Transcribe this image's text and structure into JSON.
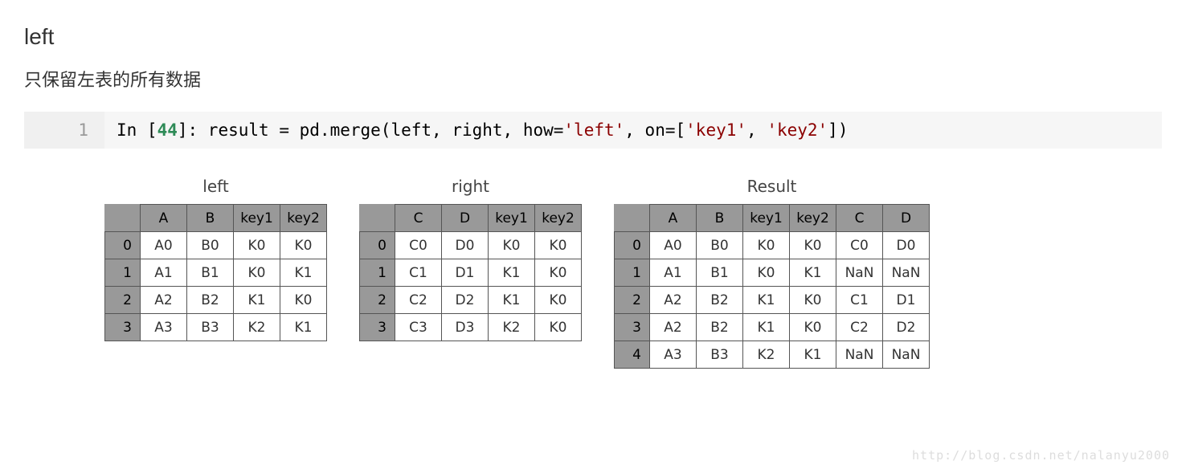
{
  "heading": "left",
  "description": "只保留左表的所有数据",
  "code": {
    "line_number": "1",
    "prefix": "In [",
    "cell_num": "44",
    "suffix1": "]: result ",
    "eq": "=",
    "suffix2": " pd",
    "dot": ".",
    "merge": "merge",
    "paren_open": "(",
    "arg_left": "left",
    "comma1": ", ",
    "arg_right": "right",
    "comma2": ", how",
    "eq2": "=",
    "str_left": "'left'",
    "comma3": ", on",
    "eq3": "=",
    "br_open": "[",
    "str_key1": "'key1'",
    "comma4": ", ",
    "str_key2": "'key2'",
    "br_close": "]",
    "paren_close": ")"
  },
  "tables": {
    "left": {
      "title": "left",
      "columns": [
        "A",
        "B",
        "key1",
        "key2"
      ],
      "index": [
        "0",
        "1",
        "2",
        "3"
      ],
      "data": [
        [
          "A0",
          "B0",
          "K0",
          "K0"
        ],
        [
          "A1",
          "B1",
          "K0",
          "K1"
        ],
        [
          "A2",
          "B2",
          "K1",
          "K0"
        ],
        [
          "A3",
          "B3",
          "K2",
          "K1"
        ]
      ]
    },
    "right": {
      "title": "right",
      "columns": [
        "C",
        "D",
        "key1",
        "key2"
      ],
      "index": [
        "0",
        "1",
        "2",
        "3"
      ],
      "data": [
        [
          "C0",
          "D0",
          "K0",
          "K0"
        ],
        [
          "C1",
          "D1",
          "K1",
          "K0"
        ],
        [
          "C2",
          "D2",
          "K1",
          "K0"
        ],
        [
          "C3",
          "D3",
          "K2",
          "K0"
        ]
      ]
    },
    "result": {
      "title": "Result",
      "columns": [
        "A",
        "B",
        "key1",
        "key2",
        "C",
        "D"
      ],
      "index": [
        "0",
        "1",
        "2",
        "3",
        "4"
      ],
      "data": [
        [
          "A0",
          "B0",
          "K0",
          "K0",
          "C0",
          "D0"
        ],
        [
          "A1",
          "B1",
          "K0",
          "K1",
          "NaN",
          "NaN"
        ],
        [
          "A2",
          "B2",
          "K1",
          "K0",
          "C1",
          "D1"
        ],
        [
          "A2",
          "B2",
          "K1",
          "K0",
          "C2",
          "D2"
        ],
        [
          "A3",
          "B3",
          "K2",
          "K1",
          "NaN",
          "NaN"
        ]
      ]
    }
  },
  "watermark": "http://blog.csdn.net/nalanyu2000",
  "chart_data": [
    {
      "type": "table",
      "title": "left",
      "columns": [
        "A",
        "B",
        "key1",
        "key2"
      ],
      "index": [
        0,
        1,
        2,
        3
      ],
      "data": [
        [
          "A0",
          "B0",
          "K0",
          "K0"
        ],
        [
          "A1",
          "B1",
          "K0",
          "K1"
        ],
        [
          "A2",
          "B2",
          "K1",
          "K0"
        ],
        [
          "A3",
          "B3",
          "K2",
          "K1"
        ]
      ]
    },
    {
      "type": "table",
      "title": "right",
      "columns": [
        "C",
        "D",
        "key1",
        "key2"
      ],
      "index": [
        0,
        1,
        2,
        3
      ],
      "data": [
        [
          "C0",
          "D0",
          "K0",
          "K0"
        ],
        [
          "C1",
          "D1",
          "K1",
          "K0"
        ],
        [
          "C2",
          "D2",
          "K1",
          "K0"
        ],
        [
          "C3",
          "D3",
          "K2",
          "K0"
        ]
      ]
    },
    {
      "type": "table",
      "title": "Result",
      "columns": [
        "A",
        "B",
        "key1",
        "key2",
        "C",
        "D"
      ],
      "index": [
        0,
        1,
        2,
        3,
        4
      ],
      "data": [
        [
          "A0",
          "B0",
          "K0",
          "K0",
          "C0",
          "D0"
        ],
        [
          "A1",
          "B1",
          "K0",
          "K1",
          "NaN",
          "NaN"
        ],
        [
          "A2",
          "B2",
          "K1",
          "K0",
          "C1",
          "D1"
        ],
        [
          "A2",
          "B2",
          "K1",
          "K0",
          "C2",
          "D2"
        ],
        [
          "A3",
          "B3",
          "K2",
          "K1",
          "NaN",
          "NaN"
        ]
      ]
    }
  ]
}
